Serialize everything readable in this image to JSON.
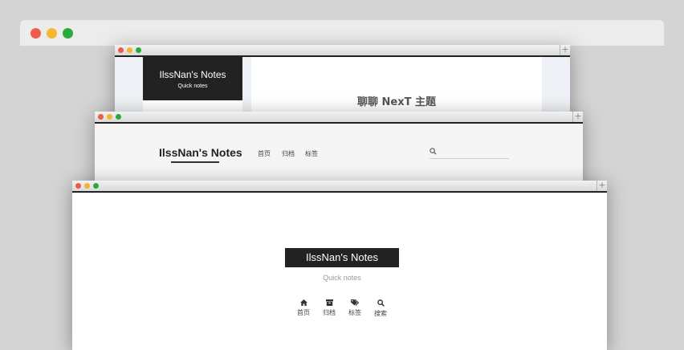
{
  "colors": {
    "backdrop": "#d4d4d4",
    "chrome": "#ececec",
    "traffic_red": "#f05a4f",
    "traffic_yellow": "#f5b72e",
    "traffic_green": "#27ac3b",
    "brand_dark": "#222222"
  },
  "window_pisces": {
    "brand_title": "IlssNan's Notes",
    "brand_subtitle": "Quick notes",
    "post_title": "聊聊 NexT 主题",
    "new_tab": "+"
  },
  "window_mist": {
    "brand_title": "IlssNan's Notes",
    "nav": [
      "首页",
      "归档",
      "标签"
    ],
    "search_icon": "search-icon",
    "new_tab": "+"
  },
  "window_muse": {
    "brand_title": "IlssNan's Notes",
    "brand_subtitle": "Quick notes",
    "new_tab": "+",
    "nav": [
      {
        "label": "首页",
        "icon": "home-icon"
      },
      {
        "label": "归档",
        "icon": "archive-icon"
      },
      {
        "label": "标签",
        "icon": "tags-icon"
      },
      {
        "label": "搜索",
        "icon": "search-icon"
      }
    ]
  }
}
